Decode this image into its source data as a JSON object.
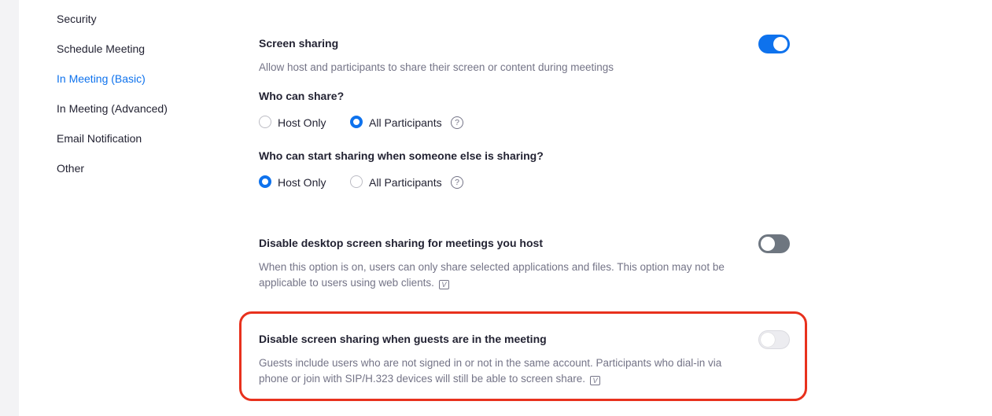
{
  "sidebar": {
    "items": [
      {
        "label": "Security",
        "active": false
      },
      {
        "label": "Schedule Meeting",
        "active": false
      },
      {
        "label": "In Meeting (Basic)",
        "active": true
      },
      {
        "label": "In Meeting (Advanced)",
        "active": false
      },
      {
        "label": "Email Notification",
        "active": false
      },
      {
        "label": "Other",
        "active": false
      }
    ]
  },
  "settings": {
    "screen_sharing": {
      "title": "Screen sharing",
      "description": "Allow host and participants to share their screen or content during meetings",
      "toggle": "on",
      "who_can_share": {
        "label": "Who can share?",
        "options": [
          "Host Only",
          "All Participants"
        ],
        "selected": "All Participants"
      },
      "who_can_start": {
        "label": "Who can start sharing when someone else is sharing?",
        "options": [
          "Host Only",
          "All Participants"
        ],
        "selected": "Host Only"
      }
    },
    "disable_desktop": {
      "title": "Disable desktop screen sharing for meetings you host",
      "description": "When this option is on, users can only share selected applications and files. This option may not be applicable to users using web clients.",
      "toggle": "off"
    },
    "disable_guests": {
      "title": "Disable screen sharing when guests are in the meeting",
      "description": "Guests include users who are not signed in or not in the same account. Participants who dial-in via phone or join with SIP/H.323 devices will still be able to screen share.",
      "toggle": "off-disabled"
    }
  },
  "icons": {
    "help": "?",
    "version": "V"
  },
  "colors": {
    "accent": "#0e72ed",
    "highlight": "#e8311d",
    "toggle_off": "#6e7680"
  }
}
